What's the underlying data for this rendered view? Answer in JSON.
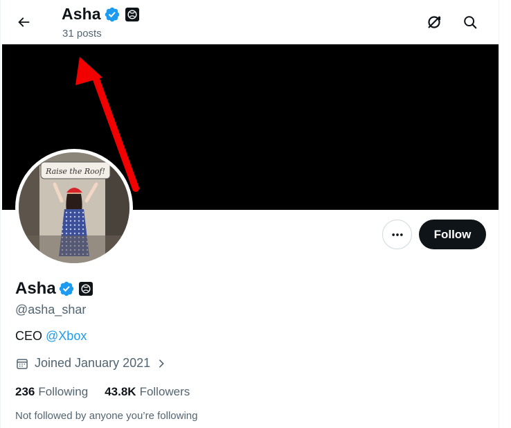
{
  "header": {
    "name": "Asha",
    "posts_count": "31 posts",
    "back_icon": "arrow-left-icon",
    "grok_icon": "grok-icon",
    "search_icon": "search-icon"
  },
  "banner": {
    "color": "#000000"
  },
  "avatar": {
    "sign_text": "Raise the Roof!"
  },
  "actions": {
    "more_icon": "more-dots-icon",
    "follow_label": "Follow"
  },
  "profile": {
    "name": "Asha",
    "handle": "@asha_shar",
    "bio_prefix": "CEO",
    "bio_link": "@Xbox",
    "joined": "Joined January 2021",
    "following_count": "236",
    "following_label": "Following",
    "followers_count": "43.8K",
    "followers_label": "Followers",
    "not_followed": "Not followed by anyone you’re following"
  },
  "colors": {
    "verified_blue": "#1d9bf0",
    "link_blue": "#1d9bf0",
    "annotation_red": "#f20000"
  }
}
